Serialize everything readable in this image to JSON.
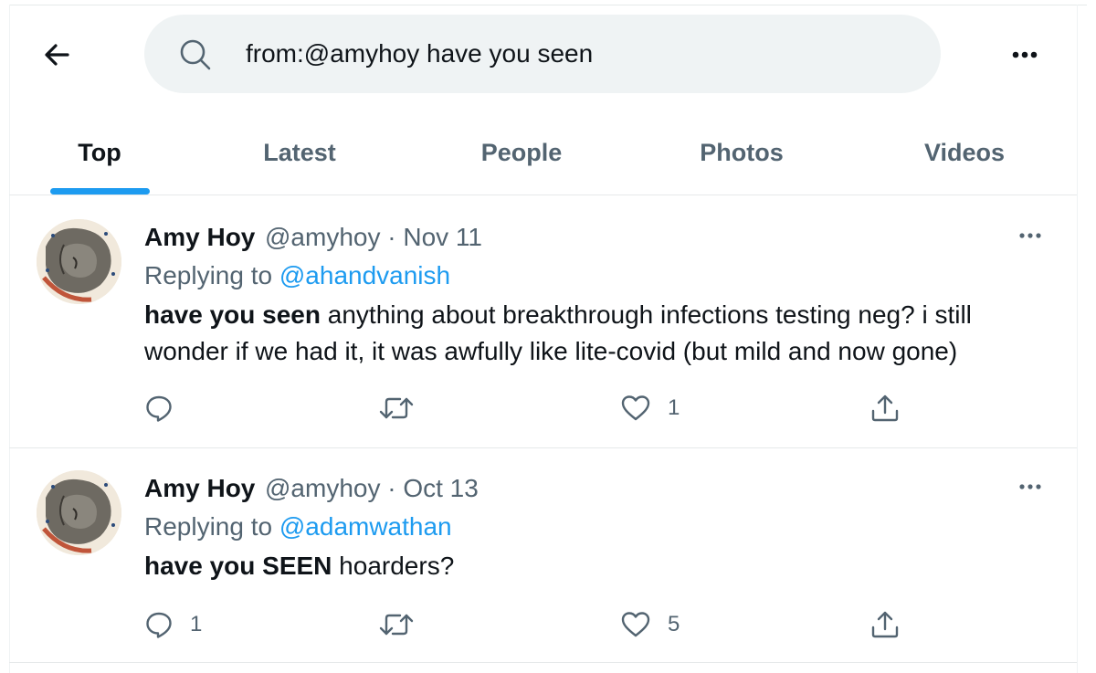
{
  "header": {
    "search_query": "from:@amyhoy have you seen"
  },
  "tabs": [
    {
      "label": "Top",
      "active": true
    },
    {
      "label": "Latest",
      "active": false
    },
    {
      "label": "People",
      "active": false
    },
    {
      "label": "Photos",
      "active": false
    },
    {
      "label": "Videos",
      "active": false
    }
  ],
  "tweets": [
    {
      "name": "Amy Hoy",
      "handle_date": "@amyhoy · Nov 11",
      "replying_prefix": "Replying to ",
      "replying_to": "@ahandvanish",
      "highlight": "have you seen",
      "text": " anything about breakthrough infections testing neg? i still wonder if we had it, it was awfully like lite-covid (but mild and now gone)",
      "replies": "",
      "retweets": "",
      "likes": "1"
    },
    {
      "name": "Amy Hoy",
      "handle_date": "@amyhoy · Oct 13",
      "replying_prefix": "Replying to ",
      "replying_to": "@adamwathan",
      "highlight": "have you SEEN",
      "text": " hoarders?",
      "replies": "1",
      "retweets": "",
      "likes": "5"
    }
  ],
  "colors": {
    "accent": "#1d9bf0",
    "secondary_text": "#536471",
    "primary_text": "#0f1419",
    "search_bg": "#eff3f4"
  },
  "icons": [
    "back-arrow-icon",
    "search-icon",
    "more-icon",
    "reply-icon",
    "retweet-icon",
    "like-icon",
    "share-icon"
  ]
}
